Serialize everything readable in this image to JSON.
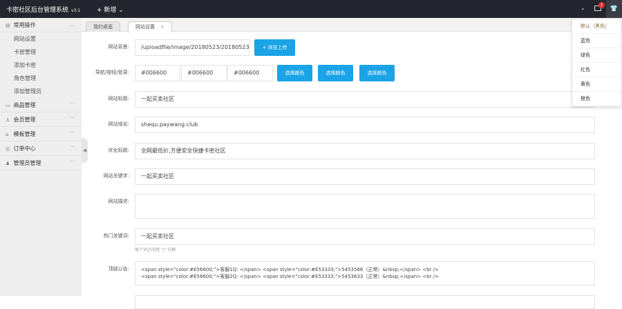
{
  "header": {
    "title": "卡密社区后台管理系统",
    "version": "v3.1",
    "new_label": "+ 新增 ⌄",
    "notif_count": "!"
  },
  "sidebar": {
    "groups": [
      {
        "label": "常用操作",
        "icon": "▤",
        "items": [
          "网站设置",
          "卡密管理",
          "添加卡密",
          "角色管理",
          "添加管理员"
        ]
      },
      {
        "label": "商品管理",
        "icon": "▭"
      },
      {
        "label": "会员管理",
        "icon": "♙"
      },
      {
        "label": "模板管理",
        "icon": "⌂"
      },
      {
        "label": "订单中心",
        "icon": "◎"
      },
      {
        "label": "管理员管理",
        "icon": "♟"
      }
    ]
  },
  "tabs": [
    {
      "label": "我的桌面"
    },
    {
      "label": "网站设置",
      "close": "×"
    }
  ],
  "form": {
    "bg": {
      "label": "网站背景:",
      "value": "/uploadfile/image/20180523/20180523",
      "button": "+ 浏览上传"
    },
    "colors": {
      "label": "导航/按钮/登录:",
      "values": [
        "#006600",
        "#006600",
        "#006600"
      ],
      "button": "选择颜色"
    },
    "title": {
      "label": "网站标题:",
      "value": "一起买卖社区"
    },
    "domain": {
      "label": "网站域名:",
      "value": "shequ.paywang.club"
    },
    "seo_title": {
      "label": "优化标题:",
      "value": "全网最低价,方便安全快捷卡密社区"
    },
    "keywords": {
      "label": "网站关键字:",
      "value": "一起买卖社区"
    },
    "desc": {
      "label": "网站描述:",
      "value": ""
    },
    "hot": {
      "label": "热门关键词:",
      "value": "一起买卖社区",
      "hint": "每个词之间用 \"|\" 分割"
    },
    "notice": {
      "label": "顶部公告:",
      "lines": [
        "<span style=\"color:#E56600;\">客服1Q:  </span> <span style=\"color:#E53333;\">5453566（正常）&nbsp;</span> <br />",
        "<span style=\"color:#E56600;\">客服2Q:  </span> <span style=\"color:#E53333;\">5453633（正常）&nbsp;</span> <br />"
      ]
    }
  },
  "theme_menu": [
    "默认（黑色）",
    "蓝色",
    "绿色",
    "红色",
    "黄色",
    "橙色"
  ]
}
